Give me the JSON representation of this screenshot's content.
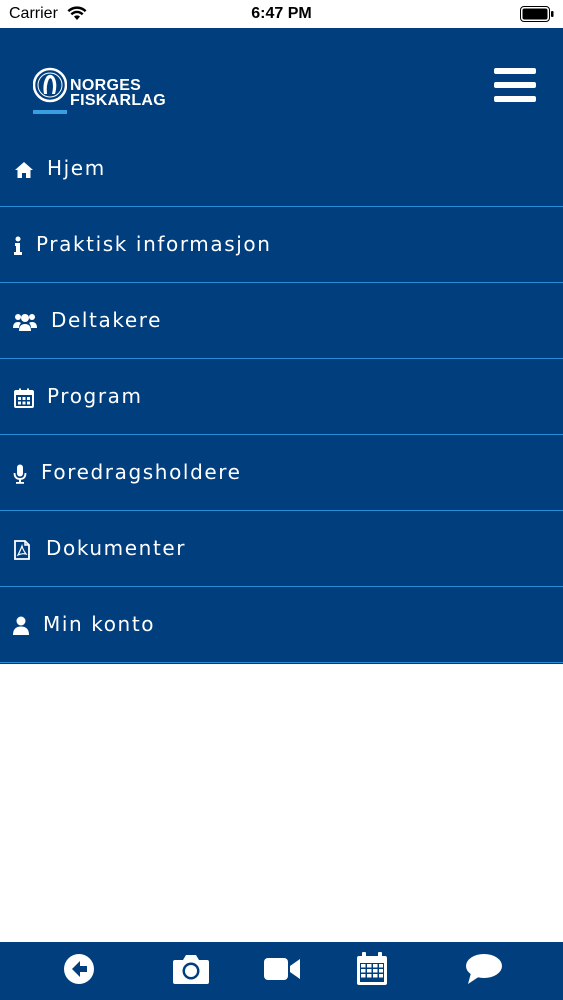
{
  "status_bar": {
    "carrier": "Carrier",
    "time": "6:47 PM",
    "wifi_icon": "wifi-icon",
    "battery_icon": "battery-icon"
  },
  "header": {
    "logo_line1": "NORGES",
    "logo_line2": "FISKARLAG",
    "menu_icon": "hamburger-menu-icon"
  },
  "colors": {
    "primary": "#003e7e",
    "divider": "#2a8fd8",
    "accent": "#3b9ee0",
    "text": "#ffffff"
  },
  "menu": {
    "items": [
      {
        "label": "Hjem",
        "icon": "home-icon"
      },
      {
        "label": "Praktisk informasjon",
        "icon": "info-icon"
      },
      {
        "label": "Deltakere",
        "icon": "users-icon"
      },
      {
        "label": "Program",
        "icon": "calendar-icon"
      },
      {
        "label": "Foredragsholdere",
        "icon": "microphone-icon"
      },
      {
        "label": "Dokumenter",
        "icon": "pdf-file-icon"
      },
      {
        "label": "Min konto",
        "icon": "user-icon"
      }
    ]
  },
  "tab_bar": {
    "items": [
      {
        "icon": "back-arrow-icon"
      },
      {
        "icon": "camera-icon"
      },
      {
        "icon": "video-camera-icon"
      },
      {
        "icon": "calendar-icon"
      },
      {
        "icon": "chat-bubble-icon"
      }
    ]
  }
}
